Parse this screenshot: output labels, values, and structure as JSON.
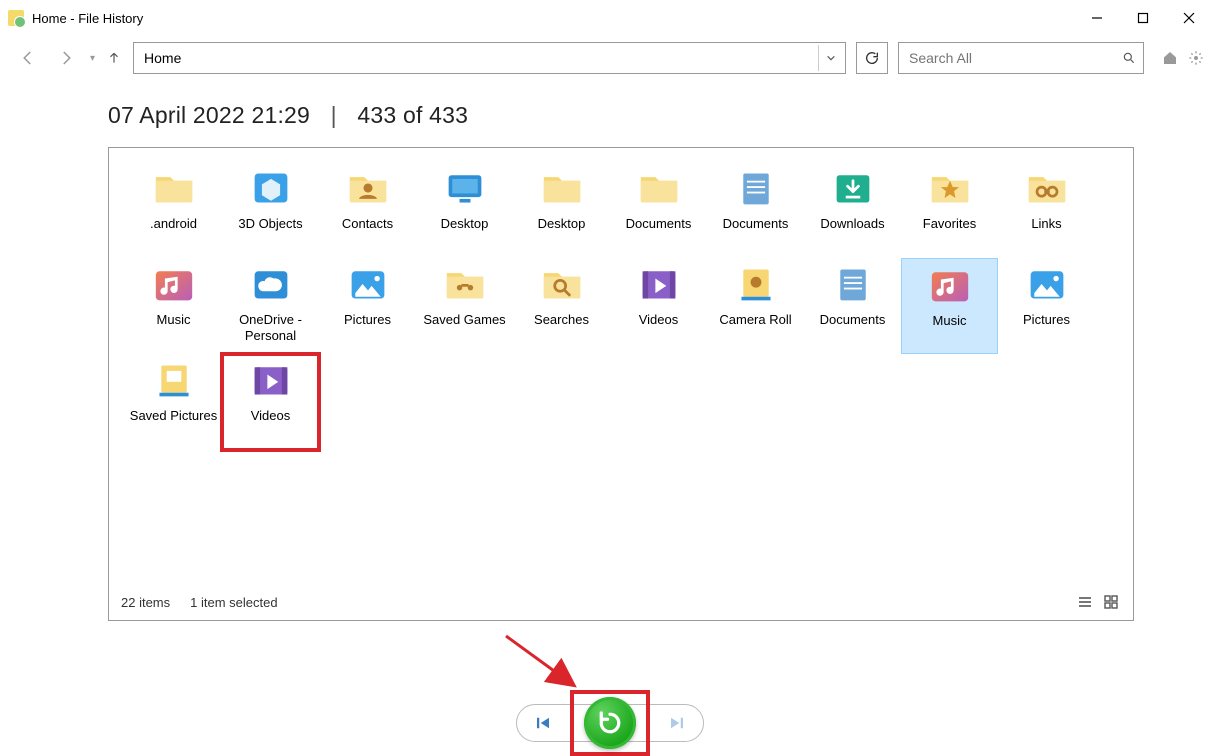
{
  "window": {
    "title": "Home - File History"
  },
  "nav": {
    "address": "Home",
    "search_placeholder": "Search All"
  },
  "header": {
    "timestamp": "07 April 2022 21:29",
    "position": "433 of 433"
  },
  "items": [
    {
      "label": ".android",
      "icon": "folder",
      "selected": false,
      "hl": false
    },
    {
      "label": "3D Objects",
      "icon": "cube",
      "selected": false,
      "hl": false
    },
    {
      "label": "Contacts",
      "icon": "contacts",
      "selected": false,
      "hl": false
    },
    {
      "label": "Desktop",
      "icon": "desktop",
      "selected": false,
      "hl": false
    },
    {
      "label": "Desktop",
      "icon": "folder",
      "selected": false,
      "hl": false
    },
    {
      "label": "Documents",
      "icon": "folder",
      "selected": false,
      "hl": false
    },
    {
      "label": "Documents",
      "icon": "documents",
      "selected": false,
      "hl": false
    },
    {
      "label": "Downloads",
      "icon": "downloads",
      "selected": false,
      "hl": false
    },
    {
      "label": "Favorites",
      "icon": "favorites",
      "selected": false,
      "hl": false
    },
    {
      "label": "Links",
      "icon": "links",
      "selected": false,
      "hl": false
    },
    {
      "label": "Music",
      "icon": "music",
      "selected": false,
      "hl": false
    },
    {
      "label": "OneDrive - Personal",
      "icon": "onedrive",
      "selected": false,
      "hl": false
    },
    {
      "label": "Pictures",
      "icon": "pictures",
      "selected": false,
      "hl": false
    },
    {
      "label": "Saved Games",
      "icon": "games",
      "selected": false,
      "hl": false
    },
    {
      "label": "Searches",
      "icon": "searches",
      "selected": false,
      "hl": false
    },
    {
      "label": "Videos",
      "icon": "videos",
      "selected": false,
      "hl": false
    },
    {
      "label": "Camera Roll",
      "icon": "camera-lib",
      "selected": false,
      "hl": false
    },
    {
      "label": "Documents",
      "icon": "documents-lib",
      "selected": false,
      "hl": false
    },
    {
      "label": "Music",
      "icon": "music-lib",
      "selected": true,
      "hl": false
    },
    {
      "label": "Pictures",
      "icon": "pictures-lib",
      "selected": false,
      "hl": false
    },
    {
      "label": "Saved Pictures",
      "icon": "saved-pictures-lib",
      "selected": false,
      "hl": false
    },
    {
      "label": "Videos",
      "icon": "videos-lib",
      "selected": false,
      "hl": true
    }
  ],
  "status": {
    "count": "22 items",
    "selection": "1 item selected"
  }
}
